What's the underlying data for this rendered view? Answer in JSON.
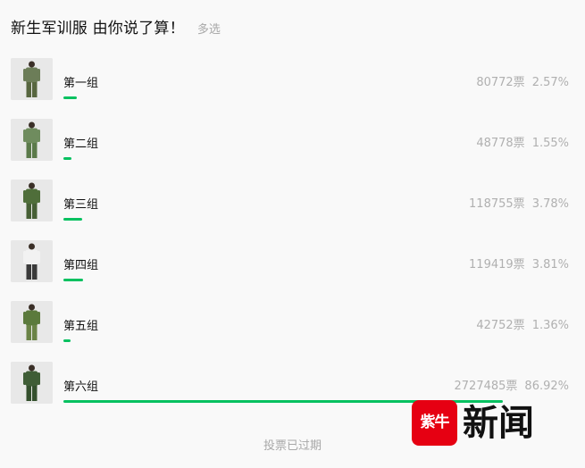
{
  "poll": {
    "title": "新生军训服 由你说了算！",
    "mode": "多选",
    "vote_unit": "票",
    "options": [
      {
        "label": "第一组",
        "votes": "80772",
        "percent": "2.57%",
        "fraction": 0.0257,
        "colors": {
          "top": "#6c7d58",
          "bottom": "#57663f"
        }
      },
      {
        "label": "第二组",
        "votes": "48778",
        "percent": "1.55%",
        "fraction": 0.0155,
        "colors": {
          "top": "#6f8c5e",
          "bottom": "#5b7a4a"
        }
      },
      {
        "label": "第三组",
        "votes": "118755",
        "percent": "3.78%",
        "fraction": 0.0378,
        "colors": {
          "top": "#4f6e3a",
          "bottom": "#465f35"
        }
      },
      {
        "label": "第四组",
        "votes": "119419",
        "percent": "3.81%",
        "fraction": 0.0381,
        "colors": {
          "top": "#f2f2f2",
          "bottom": "#3a3a3a"
        }
      },
      {
        "label": "第五组",
        "votes": "42752",
        "percent": "1.36%",
        "fraction": 0.0136,
        "colors": {
          "top": "#5b7a3c",
          "bottom": "#6a8346"
        }
      },
      {
        "label": "第六组",
        "votes": "2727485",
        "percent": "86.92%",
        "fraction": 0.8692,
        "colors": {
          "top": "#3f5d36",
          "bottom": "#34502d"
        }
      }
    ],
    "footer": "投票已过期"
  },
  "watermark": {
    "logo_text": "紫牛",
    "text": "新闻"
  },
  "colors": {
    "accent": "#07c160",
    "muted": "#b0b0b0",
    "brand_red": "#e60012"
  }
}
